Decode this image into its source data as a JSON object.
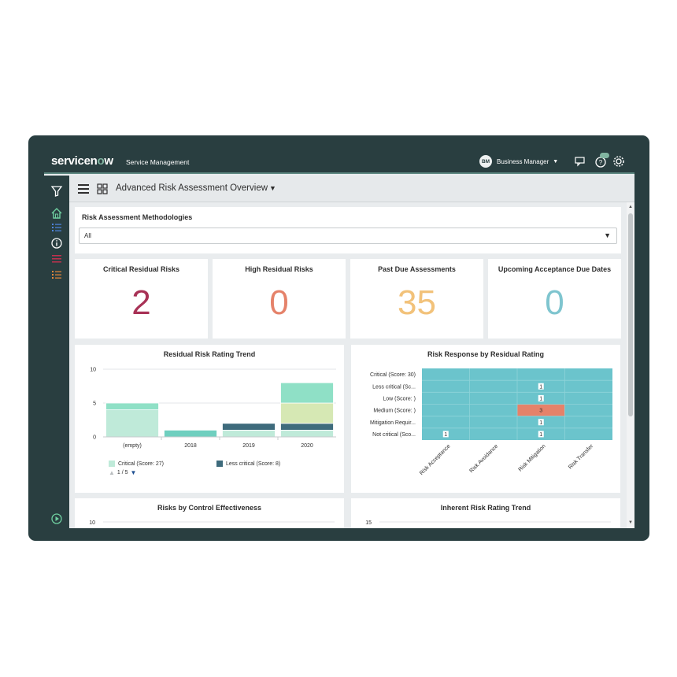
{
  "header": {
    "logo_text": "servicenow",
    "app_name": "Service Management",
    "user_initials": "BM",
    "user_name": "Business Manager",
    "icons": [
      "chat-icon",
      "help-icon",
      "settings-icon"
    ]
  },
  "leftnav": {
    "icons": [
      "filter-icon",
      "home-icon",
      "list-icon",
      "info-icon",
      "list-red-icon",
      "list-orange-icon",
      "play-icon"
    ]
  },
  "page": {
    "title": "Advanced Risk Assessment Overview",
    "filter_label": "Risk Assessment Methodologies",
    "filter_value": "All"
  },
  "kpis": [
    {
      "title": "Critical Residual Risks",
      "value": "2",
      "color": "#a83256"
    },
    {
      "title": "High Residual Risks",
      "value": "0",
      "color": "#e5826a"
    },
    {
      "title": "Past Due Assessments",
      "value": "35",
      "color": "#f2c27a"
    },
    {
      "title": "Upcoming Acceptance Due Dates",
      "value": "0",
      "color": "#7fc5cf"
    }
  ],
  "charts": {
    "trend": {
      "title": "Residual Risk Rating Trend",
      "pager": "1 / 5"
    },
    "response": {
      "title": "Risk Response by Residual Rating"
    },
    "control": {
      "title": "Risks by Control Effectiveness"
    },
    "inherent": {
      "title": "Inherent Risk Rating Trend"
    }
  },
  "chart_data": [
    {
      "type": "bar",
      "title": "Residual Risk Rating Trend",
      "categories": [
        "(empty)",
        "2018",
        "2019",
        "2020"
      ],
      "ylim": [
        0,
        10
      ],
      "yticks": [
        "10",
        "5",
        "0"
      ],
      "series": [
        {
          "name": "Critical (Score: 27)",
          "color": "#bfead9",
          "values": [
            4,
            0,
            1,
            1
          ]
        },
        {
          "name": "",
          "color": "#6fcfbf",
          "values": [
            0,
            1,
            0,
            0
          ]
        },
        {
          "name": "Less critical (Score: 8)",
          "color": "#3e6b7c",
          "values": [
            0,
            0,
            1,
            1
          ]
        },
        {
          "name": "",
          "color": "#d6e8b4",
          "values": [
            0,
            0,
            0,
            3
          ]
        },
        {
          "name": "",
          "color": "#8fe0c6",
          "values": [
            1,
            0,
            0,
            3
          ]
        }
      ],
      "legend": "bottom"
    },
    {
      "type": "heatmap",
      "title": "Risk Response by Residual Rating",
      "rows": [
        "Critical (Score: 30)",
        "Less critical (Sc...",
        "Low (Score: )",
        "Medium (Score: )",
        "Mitigation Requir...",
        "Not critical (Sco..."
      ],
      "columns": [
        "Risk Acceptance",
        "Risk Avoidance",
        "Risk Mitigation",
        "Risk Transfer"
      ],
      "cells": [
        {
          "row": 1,
          "col": 2,
          "value": "1",
          "highlight": false
        },
        {
          "row": 2,
          "col": 2,
          "value": "1",
          "highlight": false
        },
        {
          "row": 3,
          "col": 2,
          "value": "3",
          "highlight": true
        },
        {
          "row": 4,
          "col": 2,
          "value": "1",
          "highlight": false
        },
        {
          "row": 5,
          "col": 0,
          "value": "1",
          "highlight": false
        },
        {
          "row": 5,
          "col": 2,
          "value": "1",
          "highlight": false
        }
      ],
      "base_color": "#6bc4cc",
      "highlight_color": "#e5826a"
    },
    {
      "type": "bar",
      "title": "Risks by Control Effectiveness",
      "yticks": [
        "10"
      ]
    },
    {
      "type": "line",
      "title": "Inherent Risk Rating Trend",
      "yticks": [
        "15"
      ]
    }
  ]
}
